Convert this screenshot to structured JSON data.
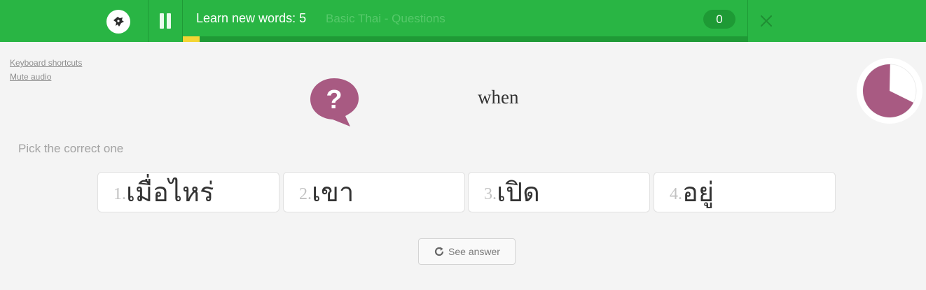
{
  "header": {
    "session_title": "Learn new words: 5",
    "course_name": "Basic Thai - Questions",
    "score": "0",
    "progress_fraction": 0.03
  },
  "links": {
    "keyboard_shortcuts": "Keyboard shortcuts",
    "mute_audio": "Mute audio"
  },
  "question": {
    "icon": "question-bubble-icon",
    "prompt": "when",
    "instruction": "Pick the correct one",
    "timer_remaining_fraction": 0.68
  },
  "choices": [
    {
      "number": "1.",
      "text": "เมื่อไหร่"
    },
    {
      "number": "2.",
      "text": "เขา"
    },
    {
      "number": "3.",
      "text": "เปิด"
    },
    {
      "number": "4.",
      "text": "อยู่"
    }
  ],
  "see_answer_label": "See answer",
  "colors": {
    "topbar": "#29b544",
    "progress": "#f4d533",
    "accent": "#a85a82",
    "background": "#f4f4f4"
  }
}
